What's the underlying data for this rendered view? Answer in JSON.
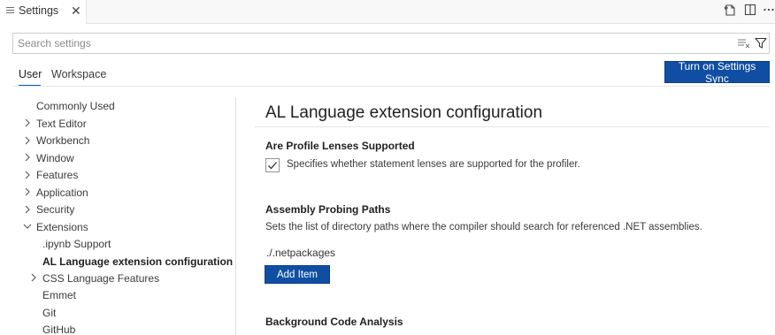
{
  "tab": {
    "title": "Settings",
    "close": "✕"
  },
  "search": {
    "placeholder": "Search settings",
    "value": ""
  },
  "scope_tabs": [
    {
      "label": "User",
      "active": true
    },
    {
      "label": "Workspace",
      "active": false
    }
  ],
  "sync_button": "Turn on Settings Sync",
  "toc": {
    "items": [
      {
        "label": "Commonly Used",
        "chevron": "none"
      },
      {
        "label": "Text Editor",
        "chevron": "right"
      },
      {
        "label": "Workbench",
        "chevron": "right"
      },
      {
        "label": "Window",
        "chevron": "right"
      },
      {
        "label": "Features",
        "chevron": "right"
      },
      {
        "label": "Application",
        "chevron": "right"
      },
      {
        "label": "Security",
        "chevron": "right"
      },
      {
        "label": "Extensions",
        "chevron": "down"
      },
      {
        "label": ".ipynb Support",
        "chevron": "none"
      },
      {
        "label": "AL Language extension configuration",
        "chevron": "none",
        "selected": true
      },
      {
        "label": "CSS Language Features",
        "chevron": "right"
      },
      {
        "label": "Emmet",
        "chevron": "none"
      },
      {
        "label": "Git",
        "chevron": "none"
      },
      {
        "label": "GitHub",
        "chevron": "none"
      }
    ]
  },
  "main": {
    "section_title": "AL Language extension configuration",
    "settings": [
      {
        "title": "Are Profile Lenses Supported",
        "checkbox_checked": true,
        "description": "Specifies whether statement lenses are supported for the profiler."
      },
      {
        "title": "Assembly Probing Paths",
        "description": "Sets the list of directory paths where the compiler should search for referenced .NET assemblies.",
        "list_values": [
          "./.netpackages"
        ],
        "add_button": "Add Item"
      },
      {
        "title": "Background Code Analysis"
      }
    ]
  },
  "colors": {
    "accent": "#0f4ea3",
    "link_underline": "#005fb8"
  }
}
